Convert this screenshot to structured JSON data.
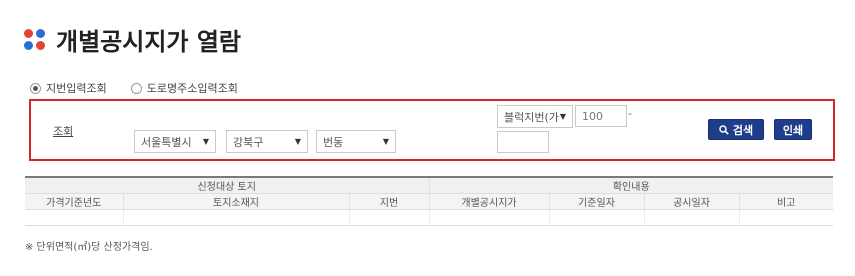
{
  "page": {
    "title": "개별공시지가 열람"
  },
  "search_mode": {
    "options": [
      {
        "label": "지번입력조회",
        "selected": true
      },
      {
        "label": "도로명주소입력조회",
        "selected": false
      }
    ]
  },
  "search_form": {
    "label": "조회",
    "sido": {
      "value": "서울특별시"
    },
    "sigungu": {
      "value": "강북구"
    },
    "dong": {
      "value": "번동"
    },
    "lot_type": {
      "value": "블럭지번(가"
    },
    "bonbeon": {
      "value": "100"
    },
    "dash": "-",
    "bubeon": {
      "value": ""
    },
    "search_button": "검색",
    "print_button": "인쇄",
    "accent_border": "#d9242b",
    "button_color": "#1f3d8a"
  },
  "result_table": {
    "group_headers": [
      "신청대상 토지",
      "확인내용"
    ],
    "columns": [
      "가격기준년도",
      "토지소재지",
      "지번",
      "개별공시지가",
      "기준일자",
      "공시일자",
      "비고"
    ],
    "rows": [
      [
        "",
        "",
        "",
        "",
        "",
        "",
        ""
      ]
    ]
  },
  "footnote": "※ 단위면적(㎡)당 산정가격임."
}
